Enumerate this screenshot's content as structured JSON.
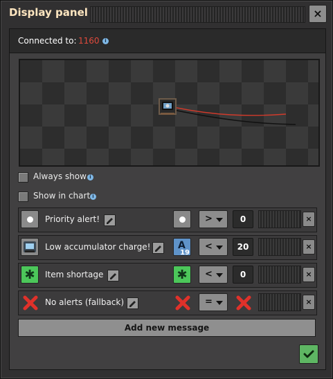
{
  "window": {
    "title": "Display panel",
    "close_label": "×"
  },
  "connection": {
    "label": "Connected to:",
    "value": "1160",
    "info": "i",
    "value_color": "#e04a3c"
  },
  "options": {
    "always_show": {
      "label": "Always show",
      "checked": false
    },
    "show_in_chart": {
      "label": "Show in chart",
      "checked": false
    }
  },
  "messages": [
    {
      "icon": "white-dot-icon",
      "text": "Priority alert!",
      "condition_icon": "white-dot-icon",
      "operator": ">",
      "value": "0",
      "delete": "×"
    },
    {
      "icon": "accumulator-icon",
      "text": "Low accumulator charge!",
      "condition_icon": "signal-a-icon",
      "condition_letter": "A",
      "condition_count": "19",
      "operator": "<",
      "value": "20",
      "delete": "×"
    },
    {
      "icon": "asterisk-icon",
      "text": "Item shortage",
      "condition_icon": "asterisk-icon",
      "operator": "<",
      "value": "0",
      "delete": "×"
    },
    {
      "icon": "red-x-icon",
      "text": "No alerts (fallback)",
      "condition_icon": "red-x-icon",
      "operator": "=",
      "value_icon": "red-x-icon",
      "delete": "×"
    }
  ],
  "buttons": {
    "add_message": "Add new message"
  },
  "colors": {
    "accent_green": "#5eb663",
    "title": "#ffe6c0",
    "alert_red": "#e04a3c"
  }
}
